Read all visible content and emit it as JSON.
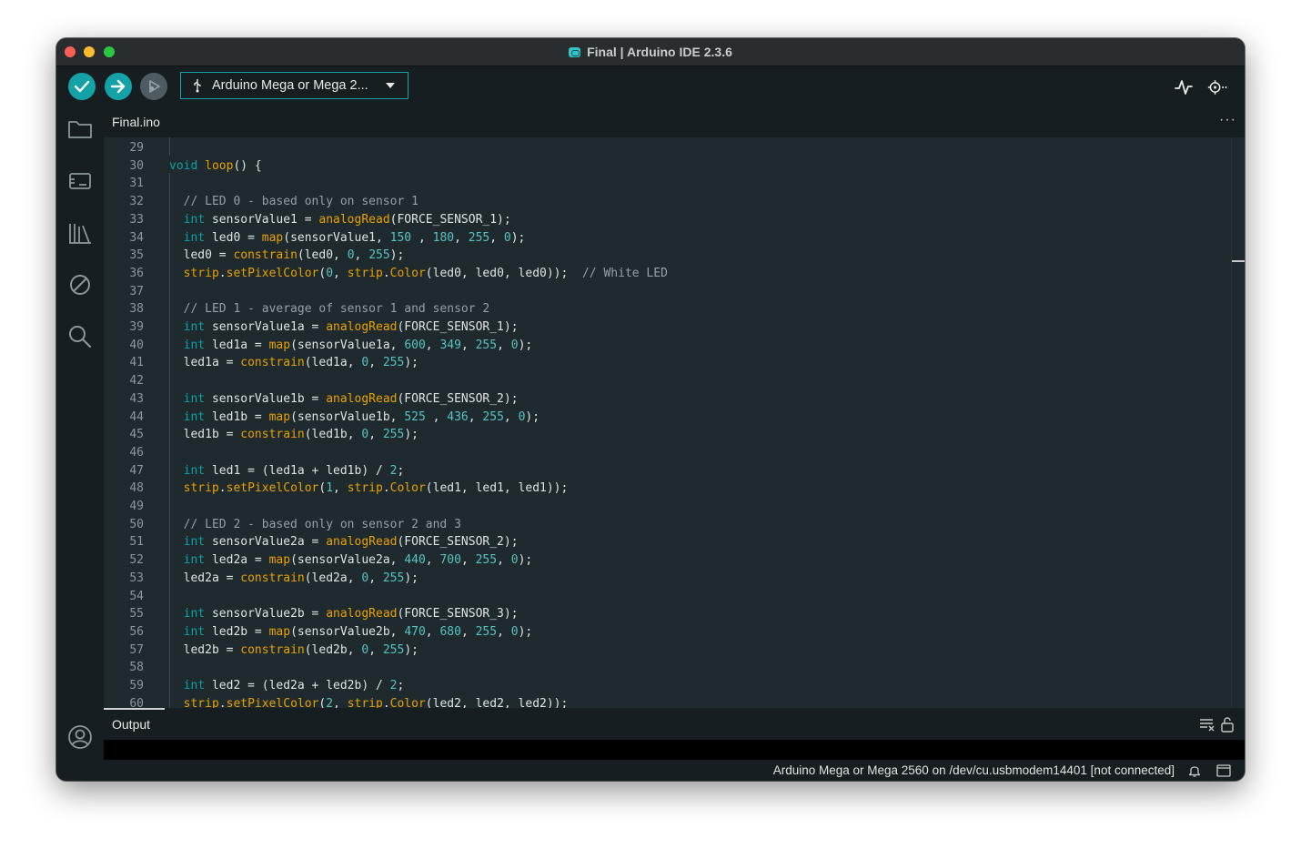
{
  "window": {
    "title": "Final | Arduino IDE 2.3.6"
  },
  "toolbar": {
    "board_label": "Arduino Mega or Mega 2...",
    "icons": [
      "verify-icon",
      "upload-icon",
      "debug-icon",
      "usb-icon",
      "serial-plotter-icon",
      "serial-monitor-icon"
    ]
  },
  "sidebar": {
    "items": [
      "sketchbook-folder-icon",
      "boards-manager-icon",
      "library-manager-icon",
      "debug-sidebar-icon",
      "search-icon"
    ],
    "bottom_icon": "account-icon"
  },
  "tabs": [
    {
      "label": "Final.ino",
      "active": true
    }
  ],
  "editor": {
    "colors": {
      "keyword": "#0ca1a6",
      "function": "#e9a100",
      "number": "#57c3c2",
      "comment": "#95a0a5",
      "text": "#dfe3e5",
      "background": "#1e2a2e"
    },
    "lines": [
      {
        "num": "29",
        "tokens": []
      },
      {
        "num": "30",
        "tokens": [
          {
            "t": "void",
            "c": "keyword"
          },
          {
            "t": " "
          },
          {
            "t": "loop",
            "c": "func"
          },
          {
            "t": "() {"
          }
        ]
      },
      {
        "num": "31",
        "tokens": []
      },
      {
        "num": "32",
        "tokens": [
          {
            "t": "  "
          },
          {
            "t": "// LED 0 - based only on sensor 1",
            "c": "comment"
          }
        ]
      },
      {
        "num": "33",
        "tokens": [
          {
            "t": "  "
          },
          {
            "t": "int",
            "c": "keyword"
          },
          {
            "t": " sensorValue1 = "
          },
          {
            "t": "analogRead",
            "c": "func"
          },
          {
            "t": "(FORCE_SENSOR_1);"
          }
        ]
      },
      {
        "num": "34",
        "tokens": [
          {
            "t": "  "
          },
          {
            "t": "int",
            "c": "keyword"
          },
          {
            "t": " led0 = "
          },
          {
            "t": "map",
            "c": "func"
          },
          {
            "t": "(sensorValue1, "
          },
          {
            "t": "150",
            "c": "number"
          },
          {
            "t": " , "
          },
          {
            "t": "180",
            "c": "number"
          },
          {
            "t": ", "
          },
          {
            "t": "255",
            "c": "number"
          },
          {
            "t": ", "
          },
          {
            "t": "0",
            "c": "number"
          },
          {
            "t": ");"
          }
        ]
      },
      {
        "num": "35",
        "tokens": [
          {
            "t": "  led0 = "
          },
          {
            "t": "constrain",
            "c": "func"
          },
          {
            "t": "(led0, "
          },
          {
            "t": "0",
            "c": "number"
          },
          {
            "t": ", "
          },
          {
            "t": "255",
            "c": "number"
          },
          {
            "t": ");"
          }
        ]
      },
      {
        "num": "36",
        "tokens": [
          {
            "t": "  "
          },
          {
            "t": "strip",
            "c": "func"
          },
          {
            "t": "."
          },
          {
            "t": "setPixelColor",
            "c": "func"
          },
          {
            "t": "("
          },
          {
            "t": "0",
            "c": "number"
          },
          {
            "t": ", "
          },
          {
            "t": "strip",
            "c": "func"
          },
          {
            "t": "."
          },
          {
            "t": "Color",
            "c": "func"
          },
          {
            "t": "(led0, led0, led0));  "
          },
          {
            "t": "// White LED",
            "c": "comment"
          }
        ]
      },
      {
        "num": "37",
        "tokens": []
      },
      {
        "num": "38",
        "tokens": [
          {
            "t": "  "
          },
          {
            "t": "// LED 1 - average of sensor 1 and sensor 2",
            "c": "comment"
          }
        ]
      },
      {
        "num": "39",
        "tokens": [
          {
            "t": "  "
          },
          {
            "t": "int",
            "c": "keyword"
          },
          {
            "t": " sensorValue1a = "
          },
          {
            "t": "analogRead",
            "c": "func"
          },
          {
            "t": "(FORCE_SENSOR_1);"
          }
        ]
      },
      {
        "num": "40",
        "tokens": [
          {
            "t": "  "
          },
          {
            "t": "int",
            "c": "keyword"
          },
          {
            "t": " led1a = "
          },
          {
            "t": "map",
            "c": "func"
          },
          {
            "t": "(sensorValue1a, "
          },
          {
            "t": "600",
            "c": "number"
          },
          {
            "t": ", "
          },
          {
            "t": "349",
            "c": "number"
          },
          {
            "t": ", "
          },
          {
            "t": "255",
            "c": "number"
          },
          {
            "t": ", "
          },
          {
            "t": "0",
            "c": "number"
          },
          {
            "t": ");"
          }
        ]
      },
      {
        "num": "41",
        "tokens": [
          {
            "t": "  led1a = "
          },
          {
            "t": "constrain",
            "c": "func"
          },
          {
            "t": "(led1a, "
          },
          {
            "t": "0",
            "c": "number"
          },
          {
            "t": ", "
          },
          {
            "t": "255",
            "c": "number"
          },
          {
            "t": ");"
          }
        ]
      },
      {
        "num": "42",
        "tokens": []
      },
      {
        "num": "43",
        "tokens": [
          {
            "t": "  "
          },
          {
            "t": "int",
            "c": "keyword"
          },
          {
            "t": " sensorValue1b = "
          },
          {
            "t": "analogRead",
            "c": "func"
          },
          {
            "t": "(FORCE_SENSOR_2);"
          }
        ]
      },
      {
        "num": "44",
        "tokens": [
          {
            "t": "  "
          },
          {
            "t": "int",
            "c": "keyword"
          },
          {
            "t": " led1b = "
          },
          {
            "t": "map",
            "c": "func"
          },
          {
            "t": "(sensorValue1b, "
          },
          {
            "t": "525",
            "c": "number"
          },
          {
            "t": " , "
          },
          {
            "t": "436",
            "c": "number"
          },
          {
            "t": ", "
          },
          {
            "t": "255",
            "c": "number"
          },
          {
            "t": ", "
          },
          {
            "t": "0",
            "c": "number"
          },
          {
            "t": ");"
          }
        ]
      },
      {
        "num": "45",
        "tokens": [
          {
            "t": "  led1b = "
          },
          {
            "t": "constrain",
            "c": "func"
          },
          {
            "t": "(led1b, "
          },
          {
            "t": "0",
            "c": "number"
          },
          {
            "t": ", "
          },
          {
            "t": "255",
            "c": "number"
          },
          {
            "t": ");"
          }
        ]
      },
      {
        "num": "46",
        "tokens": []
      },
      {
        "num": "47",
        "tokens": [
          {
            "t": "  "
          },
          {
            "t": "int",
            "c": "keyword"
          },
          {
            "t": " led1 = (led1a + led1b) / "
          },
          {
            "t": "2",
            "c": "number"
          },
          {
            "t": ";"
          }
        ]
      },
      {
        "num": "48",
        "tokens": [
          {
            "t": "  "
          },
          {
            "t": "strip",
            "c": "func"
          },
          {
            "t": "."
          },
          {
            "t": "setPixelColor",
            "c": "func"
          },
          {
            "t": "("
          },
          {
            "t": "1",
            "c": "number"
          },
          {
            "t": ", "
          },
          {
            "t": "strip",
            "c": "func"
          },
          {
            "t": "."
          },
          {
            "t": "Color",
            "c": "func"
          },
          {
            "t": "(led1, led1, led1));"
          }
        ]
      },
      {
        "num": "49",
        "tokens": []
      },
      {
        "num": "50",
        "tokens": [
          {
            "t": "  "
          },
          {
            "t": "// LED 2 - based only on sensor 2 and 3",
            "c": "comment"
          }
        ]
      },
      {
        "num": "51",
        "tokens": [
          {
            "t": "  "
          },
          {
            "t": "int",
            "c": "keyword"
          },
          {
            "t": " sensorValue2a = "
          },
          {
            "t": "analogRead",
            "c": "func"
          },
          {
            "t": "(FORCE_SENSOR_2);"
          }
        ]
      },
      {
        "num": "52",
        "tokens": [
          {
            "t": "  "
          },
          {
            "t": "int",
            "c": "keyword"
          },
          {
            "t": " led2a = "
          },
          {
            "t": "map",
            "c": "func"
          },
          {
            "t": "(sensorValue2a, "
          },
          {
            "t": "440",
            "c": "number"
          },
          {
            "t": ", "
          },
          {
            "t": "700",
            "c": "number"
          },
          {
            "t": ", "
          },
          {
            "t": "255",
            "c": "number"
          },
          {
            "t": ", "
          },
          {
            "t": "0",
            "c": "number"
          },
          {
            "t": ");"
          }
        ]
      },
      {
        "num": "53",
        "tokens": [
          {
            "t": "  led2a = "
          },
          {
            "t": "constrain",
            "c": "func"
          },
          {
            "t": "(led2a, "
          },
          {
            "t": "0",
            "c": "number"
          },
          {
            "t": ", "
          },
          {
            "t": "255",
            "c": "number"
          },
          {
            "t": ");"
          }
        ]
      },
      {
        "num": "54",
        "tokens": []
      },
      {
        "num": "55",
        "tokens": [
          {
            "t": "  "
          },
          {
            "t": "int",
            "c": "keyword"
          },
          {
            "t": " sensorValue2b = "
          },
          {
            "t": "analogRead",
            "c": "func"
          },
          {
            "t": "(FORCE_SENSOR_3);"
          }
        ]
      },
      {
        "num": "56",
        "tokens": [
          {
            "t": "  "
          },
          {
            "t": "int",
            "c": "keyword"
          },
          {
            "t": " led2b = "
          },
          {
            "t": "map",
            "c": "func"
          },
          {
            "t": "(sensorValue2b, "
          },
          {
            "t": "470",
            "c": "number"
          },
          {
            "t": ", "
          },
          {
            "t": "680",
            "c": "number"
          },
          {
            "t": ", "
          },
          {
            "t": "255",
            "c": "number"
          },
          {
            "t": ", "
          },
          {
            "t": "0",
            "c": "number"
          },
          {
            "t": ");"
          }
        ]
      },
      {
        "num": "57",
        "tokens": [
          {
            "t": "  led2b = "
          },
          {
            "t": "constrain",
            "c": "func"
          },
          {
            "t": "(led2b, "
          },
          {
            "t": "0",
            "c": "number"
          },
          {
            "t": ", "
          },
          {
            "t": "255",
            "c": "number"
          },
          {
            "t": ");"
          }
        ]
      },
      {
        "num": "58",
        "tokens": []
      },
      {
        "num": "59",
        "tokens": [
          {
            "t": "  "
          },
          {
            "t": "int",
            "c": "keyword"
          },
          {
            "t": " led2 = (led2a + led2b) / "
          },
          {
            "t": "2",
            "c": "number"
          },
          {
            "t": ";"
          }
        ]
      },
      {
        "num": "60",
        "tokens": [
          {
            "t": "  "
          },
          {
            "t": "strip",
            "c": "func"
          },
          {
            "t": "."
          },
          {
            "t": "setPixelColor",
            "c": "func"
          },
          {
            "t": "("
          },
          {
            "t": "2",
            "c": "number"
          },
          {
            "t": ", "
          },
          {
            "t": "strip",
            "c": "func"
          },
          {
            "t": "."
          },
          {
            "t": "Color",
            "c": "func"
          },
          {
            "t": "(led2, led2, led2));"
          }
        ]
      }
    ]
  },
  "output": {
    "title": "Output",
    "icons": [
      "clear-output-icon",
      "lock-scroll-icon"
    ]
  },
  "status": {
    "text": "Arduino Mega or Mega 2560 on /dev/cu.usbmodem14401 [not connected]",
    "icons": [
      "notification-bell-icon",
      "toggle-panel-icon"
    ]
  }
}
